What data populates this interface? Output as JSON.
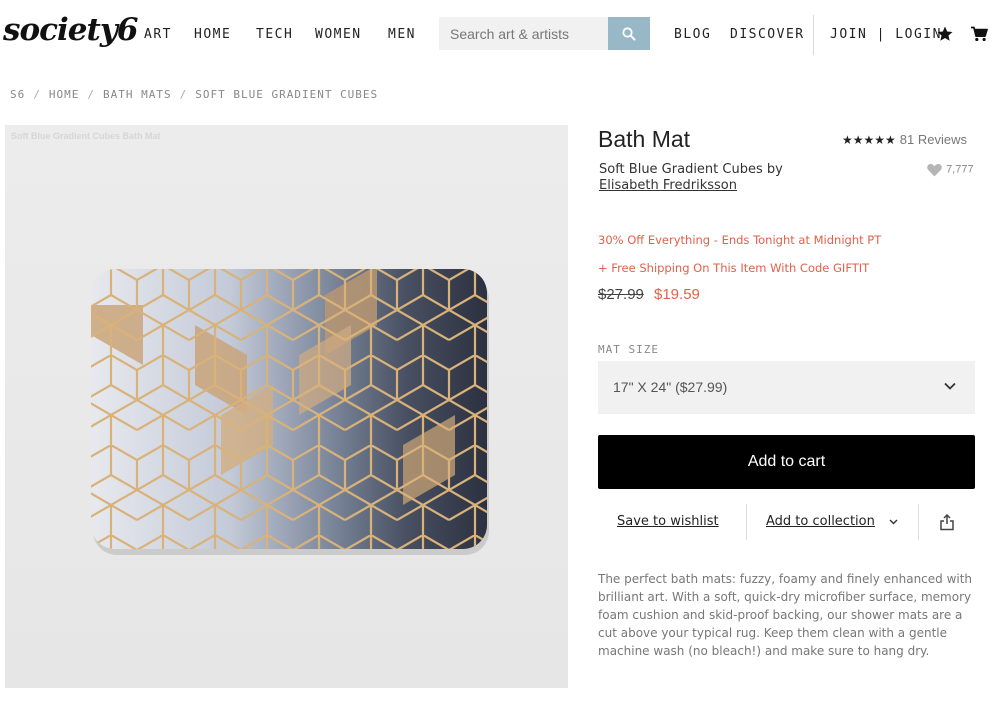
{
  "header": {
    "logo": "society6",
    "nav": [
      "ART",
      "HOME",
      "TECH",
      "WOMEN",
      "MEN"
    ],
    "search_placeholder": "Search art & artists",
    "nav_right": [
      "BLOG",
      "DISCOVER"
    ],
    "account": "JOIN | LOGIN",
    "icons": [
      "search-icon",
      "star-icon",
      "cart-icon"
    ]
  },
  "breadcrumb": [
    "S6",
    "HOME",
    "BATH MATS",
    "SOFT BLUE GRADIENT CUBES"
  ],
  "image": {
    "alt_text": "Soft Blue Gradient Cubes Bath Mat"
  },
  "product": {
    "title": "Bath Mat",
    "rating": 5,
    "reviews": "81 Reviews",
    "subtitle": "Soft Blue Gradient Cubes by",
    "artist": "Elisabeth Fredriksson",
    "likes": "7,777",
    "promo1": "30% Off Everything - Ends Tonight at Midnight PT",
    "promo2": "+ Free Shipping On This Item With Code GIFTIT",
    "price_old": "$27.99",
    "price_new": "$19.59",
    "size_label": "MAT SIZE",
    "size_value": "17\" X 24\" ($27.99)",
    "add_to_cart": "Add to cart",
    "save_wishlist": "Save to wishlist",
    "add_collection": "Add to collection",
    "description": "The perfect bath mats: fuzzy, foamy and finely enhanced with brilliant art. With a soft, quick-dry microfiber surface, memory foam cushion and skid-proof backing, our shower mats are a cut above your typical rug. Keep them clean with a gentle machine wash (no bleach!) and make sure to hang dry."
  },
  "colors": {
    "accent_sale": "#e1604a",
    "search_button": "#98b8c7",
    "button_black": "#000000"
  }
}
